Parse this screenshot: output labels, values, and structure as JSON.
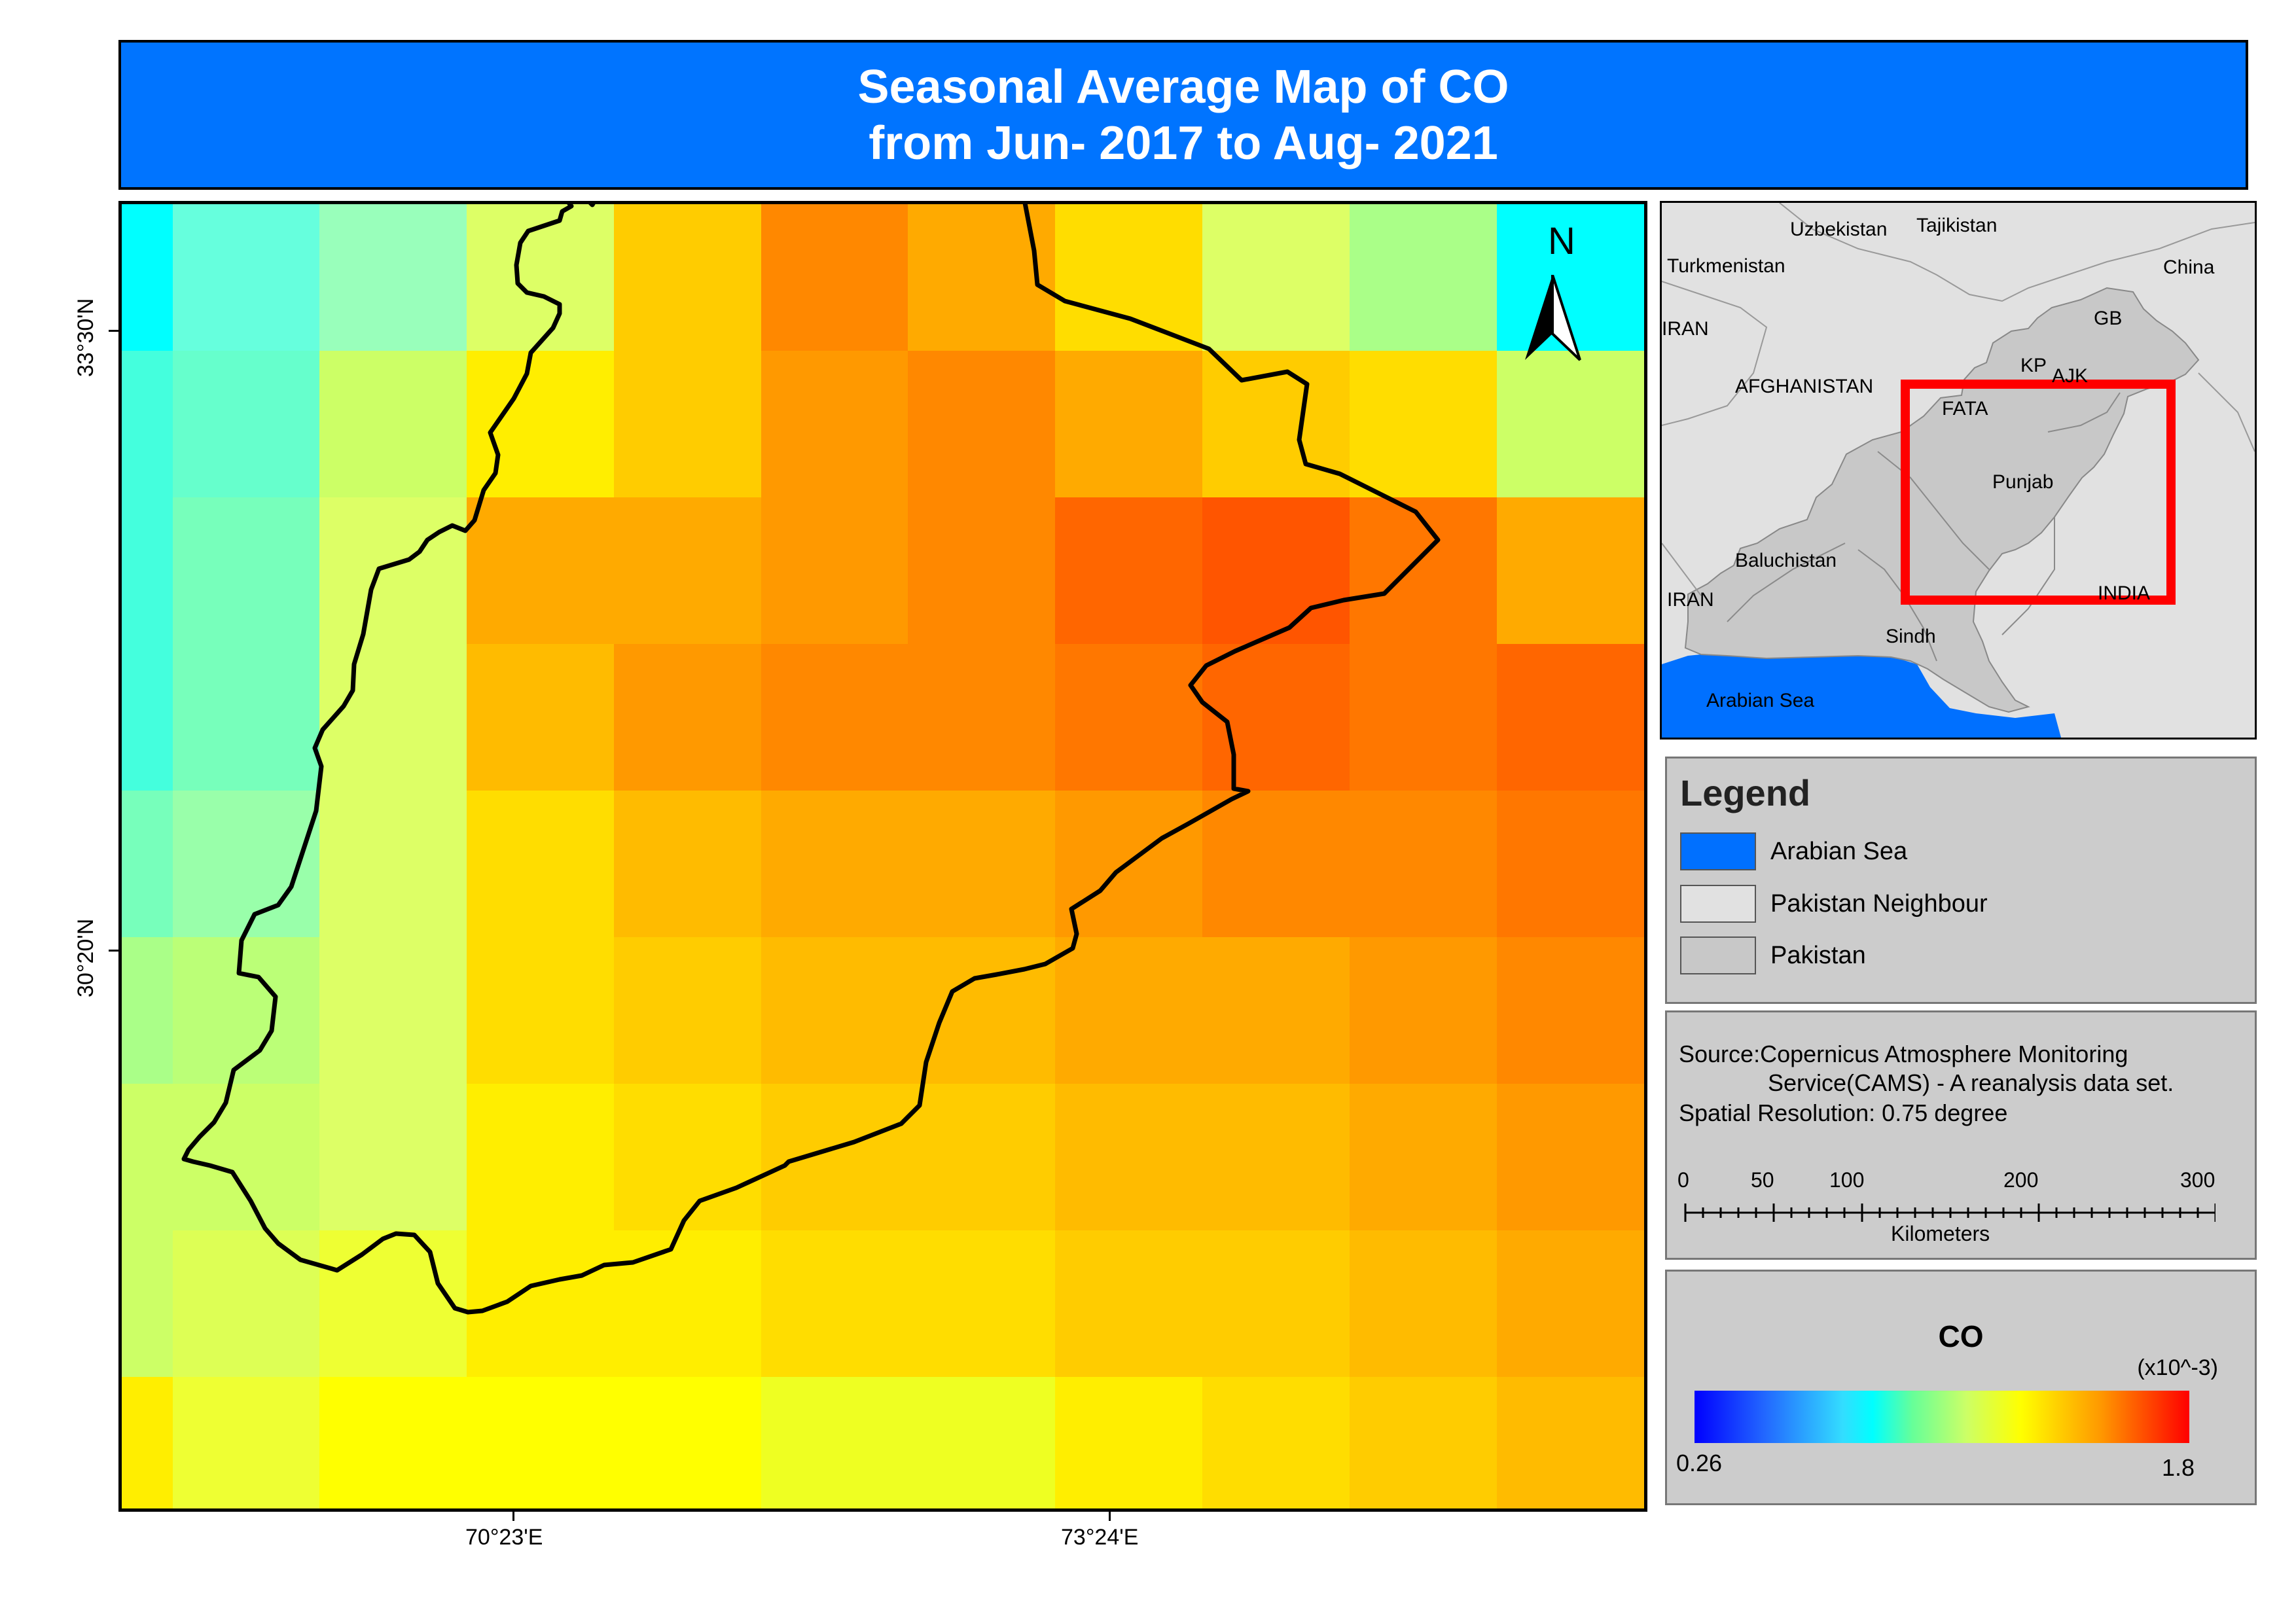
{
  "title": {
    "line1": "Seasonal  Average Map of CO",
    "line2": "from Jun- 2017 to Aug- 2021"
  },
  "map": {
    "north_label": "N",
    "lat_labels": [
      "33°30'N",
      "30°20'N"
    ],
    "lon_labels": [
      "70°23'E",
      "73°24'E"
    ],
    "colors": {
      "boundary": "#000000",
      "low": "#00ffff",
      "high": "#ff5500"
    }
  },
  "inset": {
    "labels": {
      "uzbekistan": "Uzbekistan",
      "tajikistan": "Tajikistan",
      "turkmenistan": "Turkmenistan",
      "china": "China",
      "iran_top": "IRAN",
      "gb": "GB",
      "kp": "KP",
      "ajk": "AJK",
      "afghanistan": "AFGHANISTAN",
      "fata": "FATA",
      "punjab": "Punjab",
      "baluchistan": "Baluchistan",
      "iran_bottom": "IRAN",
      "india": "INDIA",
      "sindh": "Sindh",
      "arabian_sea": "Arabian Sea"
    },
    "colors": {
      "sea": "#0070ff",
      "neighbour": "#e1e1e1",
      "pakistan": "#c8c8c8",
      "highlight": "#ff0000"
    }
  },
  "legend": {
    "title": "Legend",
    "items": [
      {
        "label": "Arabian Sea",
        "color": "#0070ff"
      },
      {
        "label": "Pakistan Neighbour",
        "color": "#e1e1e1"
      },
      {
        "label": "Pakistan",
        "color": "#c8c8c8"
      }
    ]
  },
  "source": {
    "line1": "Source:Copernicus Atmosphere Monitoring",
    "line2": "Service(CAMS) - A reanalysis data set.",
    "line3": "Spatial Resolution: 0.75 degree"
  },
  "scalebar": {
    "ticks": [
      "0",
      "50",
      "100",
      "200",
      "300"
    ],
    "unit": "Kilometers"
  },
  "colorbar": {
    "title": "CO",
    "unit": "(x10^-3)",
    "min": "0.26",
    "max": "1.8"
  }
}
